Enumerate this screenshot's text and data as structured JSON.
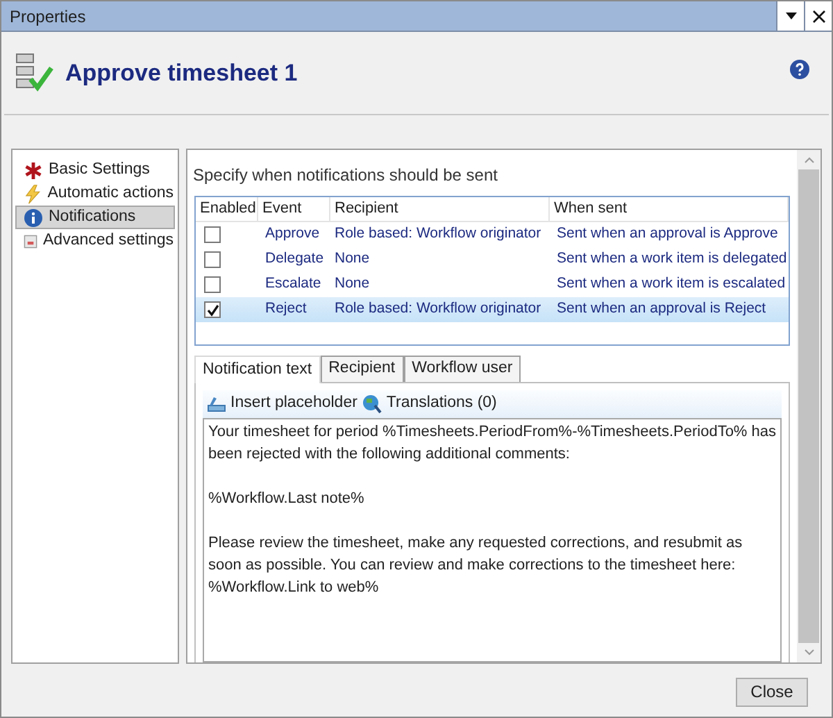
{
  "window": {
    "title": "Properties"
  },
  "header": {
    "title": "Approve timesheet 1"
  },
  "sidebar": {
    "items": [
      {
        "label": "Basic Settings",
        "selected": false
      },
      {
        "label": "Automatic actions",
        "selected": false
      },
      {
        "label": "Notifications",
        "selected": true
      },
      {
        "label": "Advanced settings",
        "selected": false
      }
    ]
  },
  "content": {
    "heading": "Specify when notifications should be sent",
    "table": {
      "columns": [
        "Enabled",
        "Event",
        "Recipient",
        "When sent"
      ],
      "rows": [
        {
          "checked": false,
          "selected": false,
          "event": "Approve",
          "recipient": "Role based: Workflow originator",
          "when_sent": "Sent when an approval is Approve"
        },
        {
          "checked": false,
          "selected": false,
          "event": "Delegate",
          "recipient": "None",
          "when_sent": "Sent when a work item is delegated"
        },
        {
          "checked": false,
          "selected": false,
          "event": "Escalate",
          "recipient": "None",
          "when_sent": "Sent when a work item is escalated"
        },
        {
          "checked": true,
          "selected": true,
          "event": "Reject",
          "recipient": "Role based: Workflow originator",
          "when_sent": "Sent when an approval is Reject"
        }
      ]
    },
    "tabs": [
      {
        "label": "Notification text",
        "selected": true
      },
      {
        "label": "Recipient",
        "selected": false
      },
      {
        "label": "Workflow user",
        "selected": false
      }
    ],
    "toolbar": [
      "Insert placeholder",
      "Translations (0)"
    ],
    "message": [
      "Your timesheet for period %Timesheets.PeriodFrom%-%Timesheets.PeriodTo% has been rejected with the following additional comments:",
      "%Workflow.Last note%",
      "Please review the timesheet, make any requested corrections, and resubmit as soon as possible.  You can review and make corrections to the timesheet here: %Workflow.Link to web%"
    ]
  },
  "buttons": [
    "Close"
  ]
}
